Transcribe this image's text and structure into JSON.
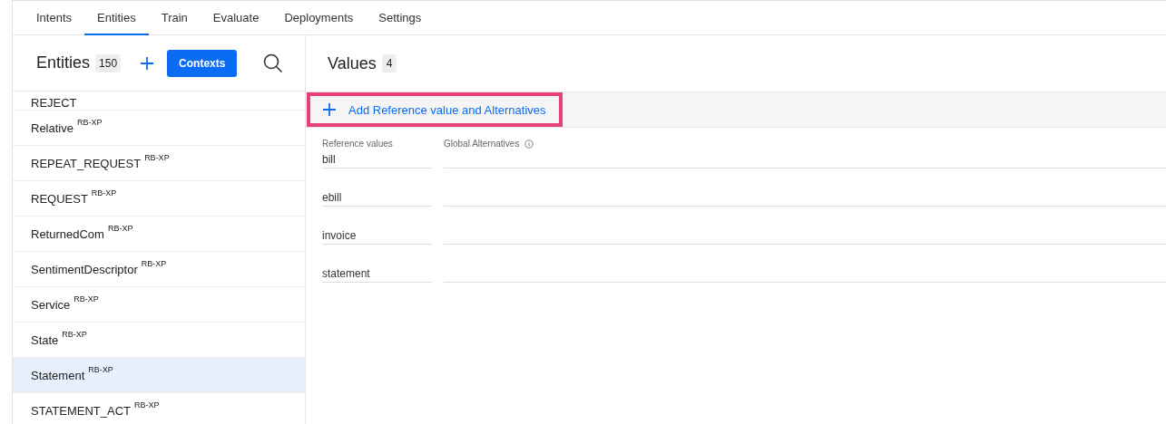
{
  "tabs": [
    {
      "label": "Intents",
      "selected": false
    },
    {
      "label": "Entities",
      "selected": true
    },
    {
      "label": "Train",
      "selected": false
    },
    {
      "label": "Evaluate",
      "selected": false
    },
    {
      "label": "Deployments",
      "selected": false
    },
    {
      "label": "Settings",
      "selected": false
    }
  ],
  "entities": {
    "title": "Entities",
    "count": "150",
    "contexts_button": "Contexts",
    "items": [
      {
        "name": "REJECT",
        "selected": false
      },
      {
        "name": "Relative",
        "badge": "RB-XP",
        "selected": false
      },
      {
        "name": "REPEAT_REQUEST",
        "badge": "RB-XP",
        "selected": false
      },
      {
        "name": "REQUEST",
        "badge": "RB-XP",
        "selected": false
      },
      {
        "name": "ReturnedCom",
        "badge": "RB-XP",
        "selected": false
      },
      {
        "name": "SentimentDescriptor",
        "badge": "RB-XP",
        "selected": false
      },
      {
        "name": "Service",
        "badge": "RB-XP",
        "selected": false
      },
      {
        "name": "State",
        "badge": "RB-XP",
        "selected": false
      },
      {
        "name": "Statement",
        "badge": "RB-XP",
        "selected": true
      },
      {
        "name": "STATEMENT_ACT",
        "badge": "RB-XP",
        "selected": false
      }
    ]
  },
  "values": {
    "title": "Values",
    "count": "4",
    "add_button": "Add Reference value and Alternatives",
    "highlighted": true,
    "columns": [
      "Reference values",
      "Global Alternatives"
    ],
    "rows": [
      {
        "reference": "bill"
      },
      {
        "reference": "ebill"
      },
      {
        "reference": "invoice"
      },
      {
        "reference": "statement"
      }
    ]
  }
}
